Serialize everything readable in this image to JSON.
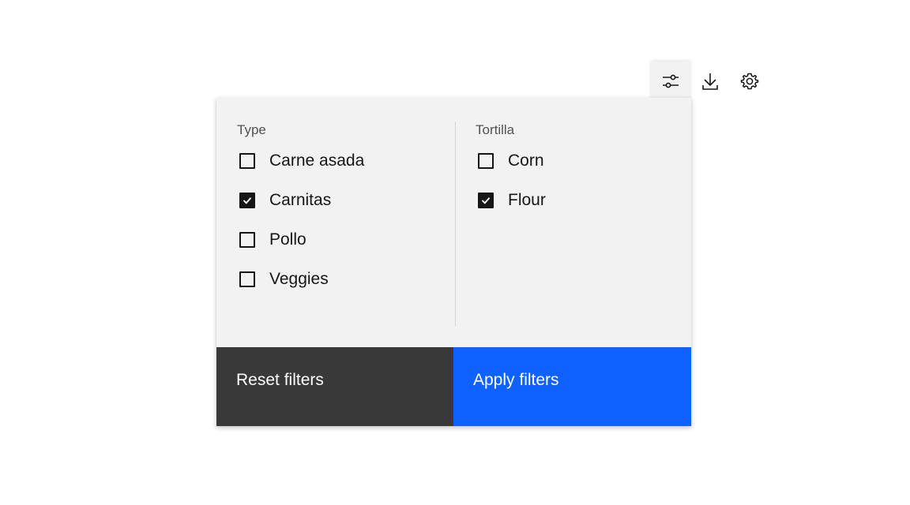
{
  "toolbar": {
    "items": [
      {
        "icon": "settings-adjust-icon",
        "active": true
      },
      {
        "icon": "download-icon",
        "active": false
      },
      {
        "icon": "settings-icon",
        "active": false
      }
    ]
  },
  "filters": {
    "type": {
      "title": "Type",
      "options": [
        {
          "label": "Carne asada",
          "checked": false
        },
        {
          "label": "Carnitas",
          "checked": true
        },
        {
          "label": "Pollo",
          "checked": false
        },
        {
          "label": "Veggies",
          "checked": false
        }
      ]
    },
    "tortilla": {
      "title": "Tortilla",
      "options": [
        {
          "label": "Corn",
          "checked": false
        },
        {
          "label": "Flour",
          "checked": true
        }
      ]
    }
  },
  "actions": {
    "reset_label": "Reset filters",
    "apply_label": "Apply filters"
  },
  "colors": {
    "panel_bg": "#f2f2f2",
    "reset_bg": "#393939",
    "apply_bg": "#0f62fe",
    "text": "#161616"
  }
}
